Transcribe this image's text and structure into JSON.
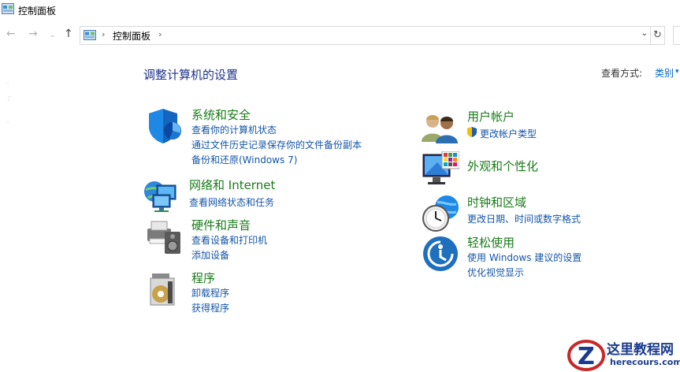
{
  "window": {
    "title": "控制面板"
  },
  "address": {
    "crumb": "控制面板"
  },
  "header": {
    "heading": "调整计算机的设置",
    "view_by_label": "查看方式:",
    "view_by_value": "类别"
  },
  "categories": [
    {
      "title": "系统和安全",
      "icon": "security-shield-icon",
      "links": [
        "查看你的计算机状态",
        "通过文件历史记录保存你的文件备份副本",
        "备份和还原(Windows 7)"
      ]
    },
    {
      "title": "网络和 Internet",
      "icon": "network-globe-icon",
      "links": [
        "查看网络状态和任务"
      ]
    },
    {
      "title": "硬件和声音",
      "icon": "printer-speaker-icon",
      "links": [
        "查看设备和打印机",
        "添加设备"
      ]
    },
    {
      "title": "程序",
      "icon": "programs-disc-icon",
      "links": [
        "卸载程序",
        "获得程序"
      ]
    },
    {
      "title": "用户帐户",
      "icon": "users-icon",
      "links": [
        "更改帐户类型"
      ]
    },
    {
      "title": "外观和个性化",
      "icon": "monitor-color-icon",
      "links": []
    },
    {
      "title": "时钟和区域",
      "icon": "clock-globe-icon",
      "links": [
        "更改日期、时间或数字格式"
      ]
    },
    {
      "title": "轻松使用",
      "icon": "ease-of-access-icon",
      "links": [
        "使用 Windows 建议的设置",
        "优化视觉显示"
      ]
    }
  ],
  "watermark": {
    "text": "这里教程网",
    "url": "herecours.com",
    "letter": "Z"
  },
  "colors": {
    "heading": "#1e3287",
    "category_title": "#1a7a1a",
    "link": "#1455a6"
  }
}
